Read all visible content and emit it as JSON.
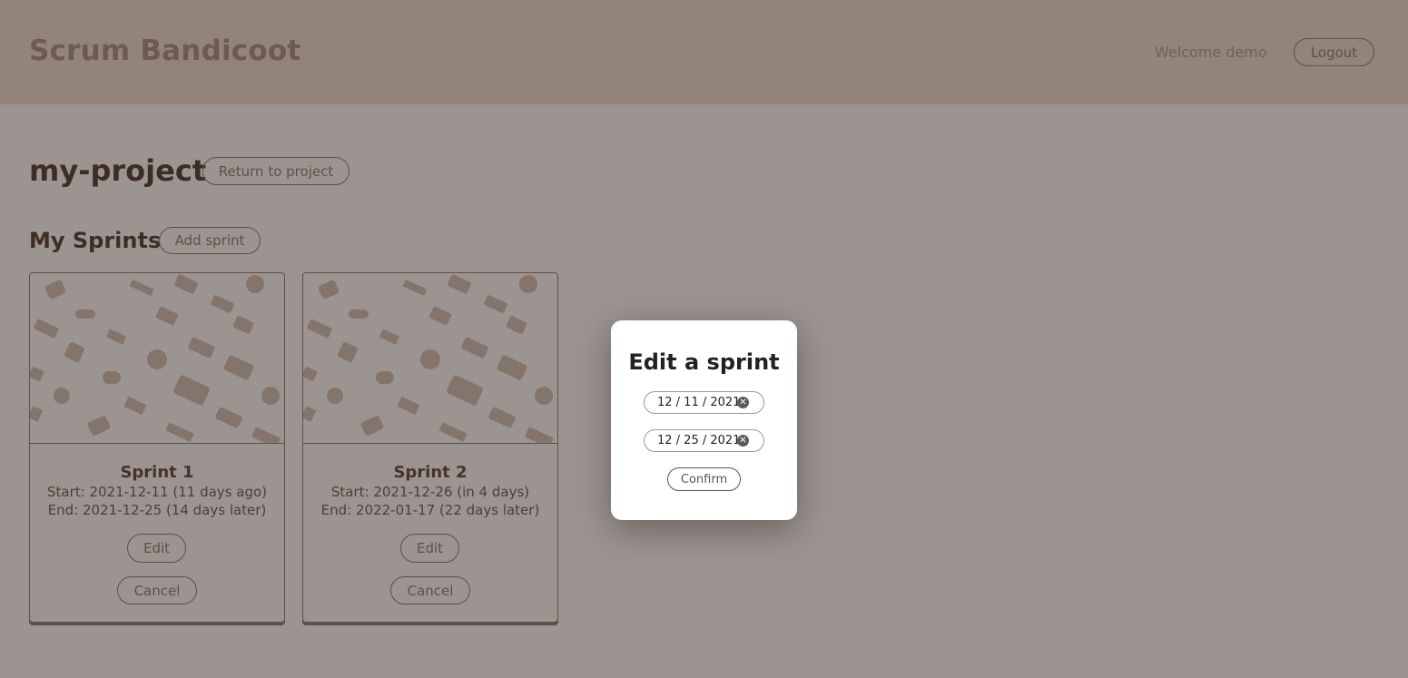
{
  "header": {
    "brand": "Scrum Bandicoot",
    "welcome": "Welcome demo",
    "logout_label": "Logout"
  },
  "project": {
    "title": "my-project",
    "return_label": "Return to project"
  },
  "sprints_section": {
    "title": "My Sprints",
    "add_label": "Add sprint"
  },
  "sprints": [
    {
      "name": "Sprint 1",
      "start": "Start: 2021-12-11 (11 days ago)",
      "end": "End: 2021-12-25 (14 days later)",
      "edit_label": "Edit",
      "cancel_label": "Cancel"
    },
    {
      "name": "Sprint 2",
      "start": "Start: 2021-12-26 (in 4 days)",
      "end": "End: 2022-01-17 (22 days later)",
      "edit_label": "Edit",
      "cancel_label": "Cancel"
    }
  ],
  "modal": {
    "title": "Edit a sprint",
    "start_date": "12 / 11 / 2021",
    "end_date": "12 / 25 / 2021",
    "confirm_label": "Confirm"
  },
  "icons": {
    "clear": "clear-circle-icon",
    "card_pattern": "business-icons-pattern"
  },
  "colors": {
    "header_bg": "#e6d8d0",
    "text_dark": "#4d3b34",
    "border": "#8a7a70",
    "overlay": "rgba(45,28,20,0.45)"
  }
}
